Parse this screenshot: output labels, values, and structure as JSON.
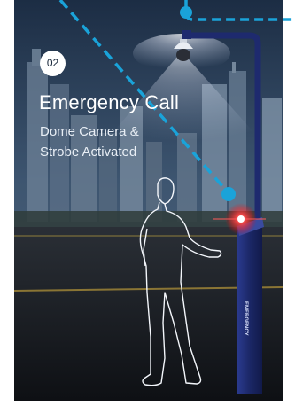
{
  "step": {
    "badge": "02",
    "title": "Emergency Call",
    "subtitle_line1": "Dome Camera &",
    "subtitle_line2": "Strobe Activated"
  },
  "pole": {
    "label": "EMERGENCY"
  },
  "colors": {
    "connector_line": "#1aa3d9",
    "connector_dot": "#1aa3d9",
    "pole": "#1e2a6e",
    "strobe": "#ff2a2a",
    "lamp_light": "#eef3ff"
  },
  "icons": [
    "dome-camera-icon",
    "strobe-light-icon",
    "person-outline-icon",
    "connector-dot-icon"
  ]
}
